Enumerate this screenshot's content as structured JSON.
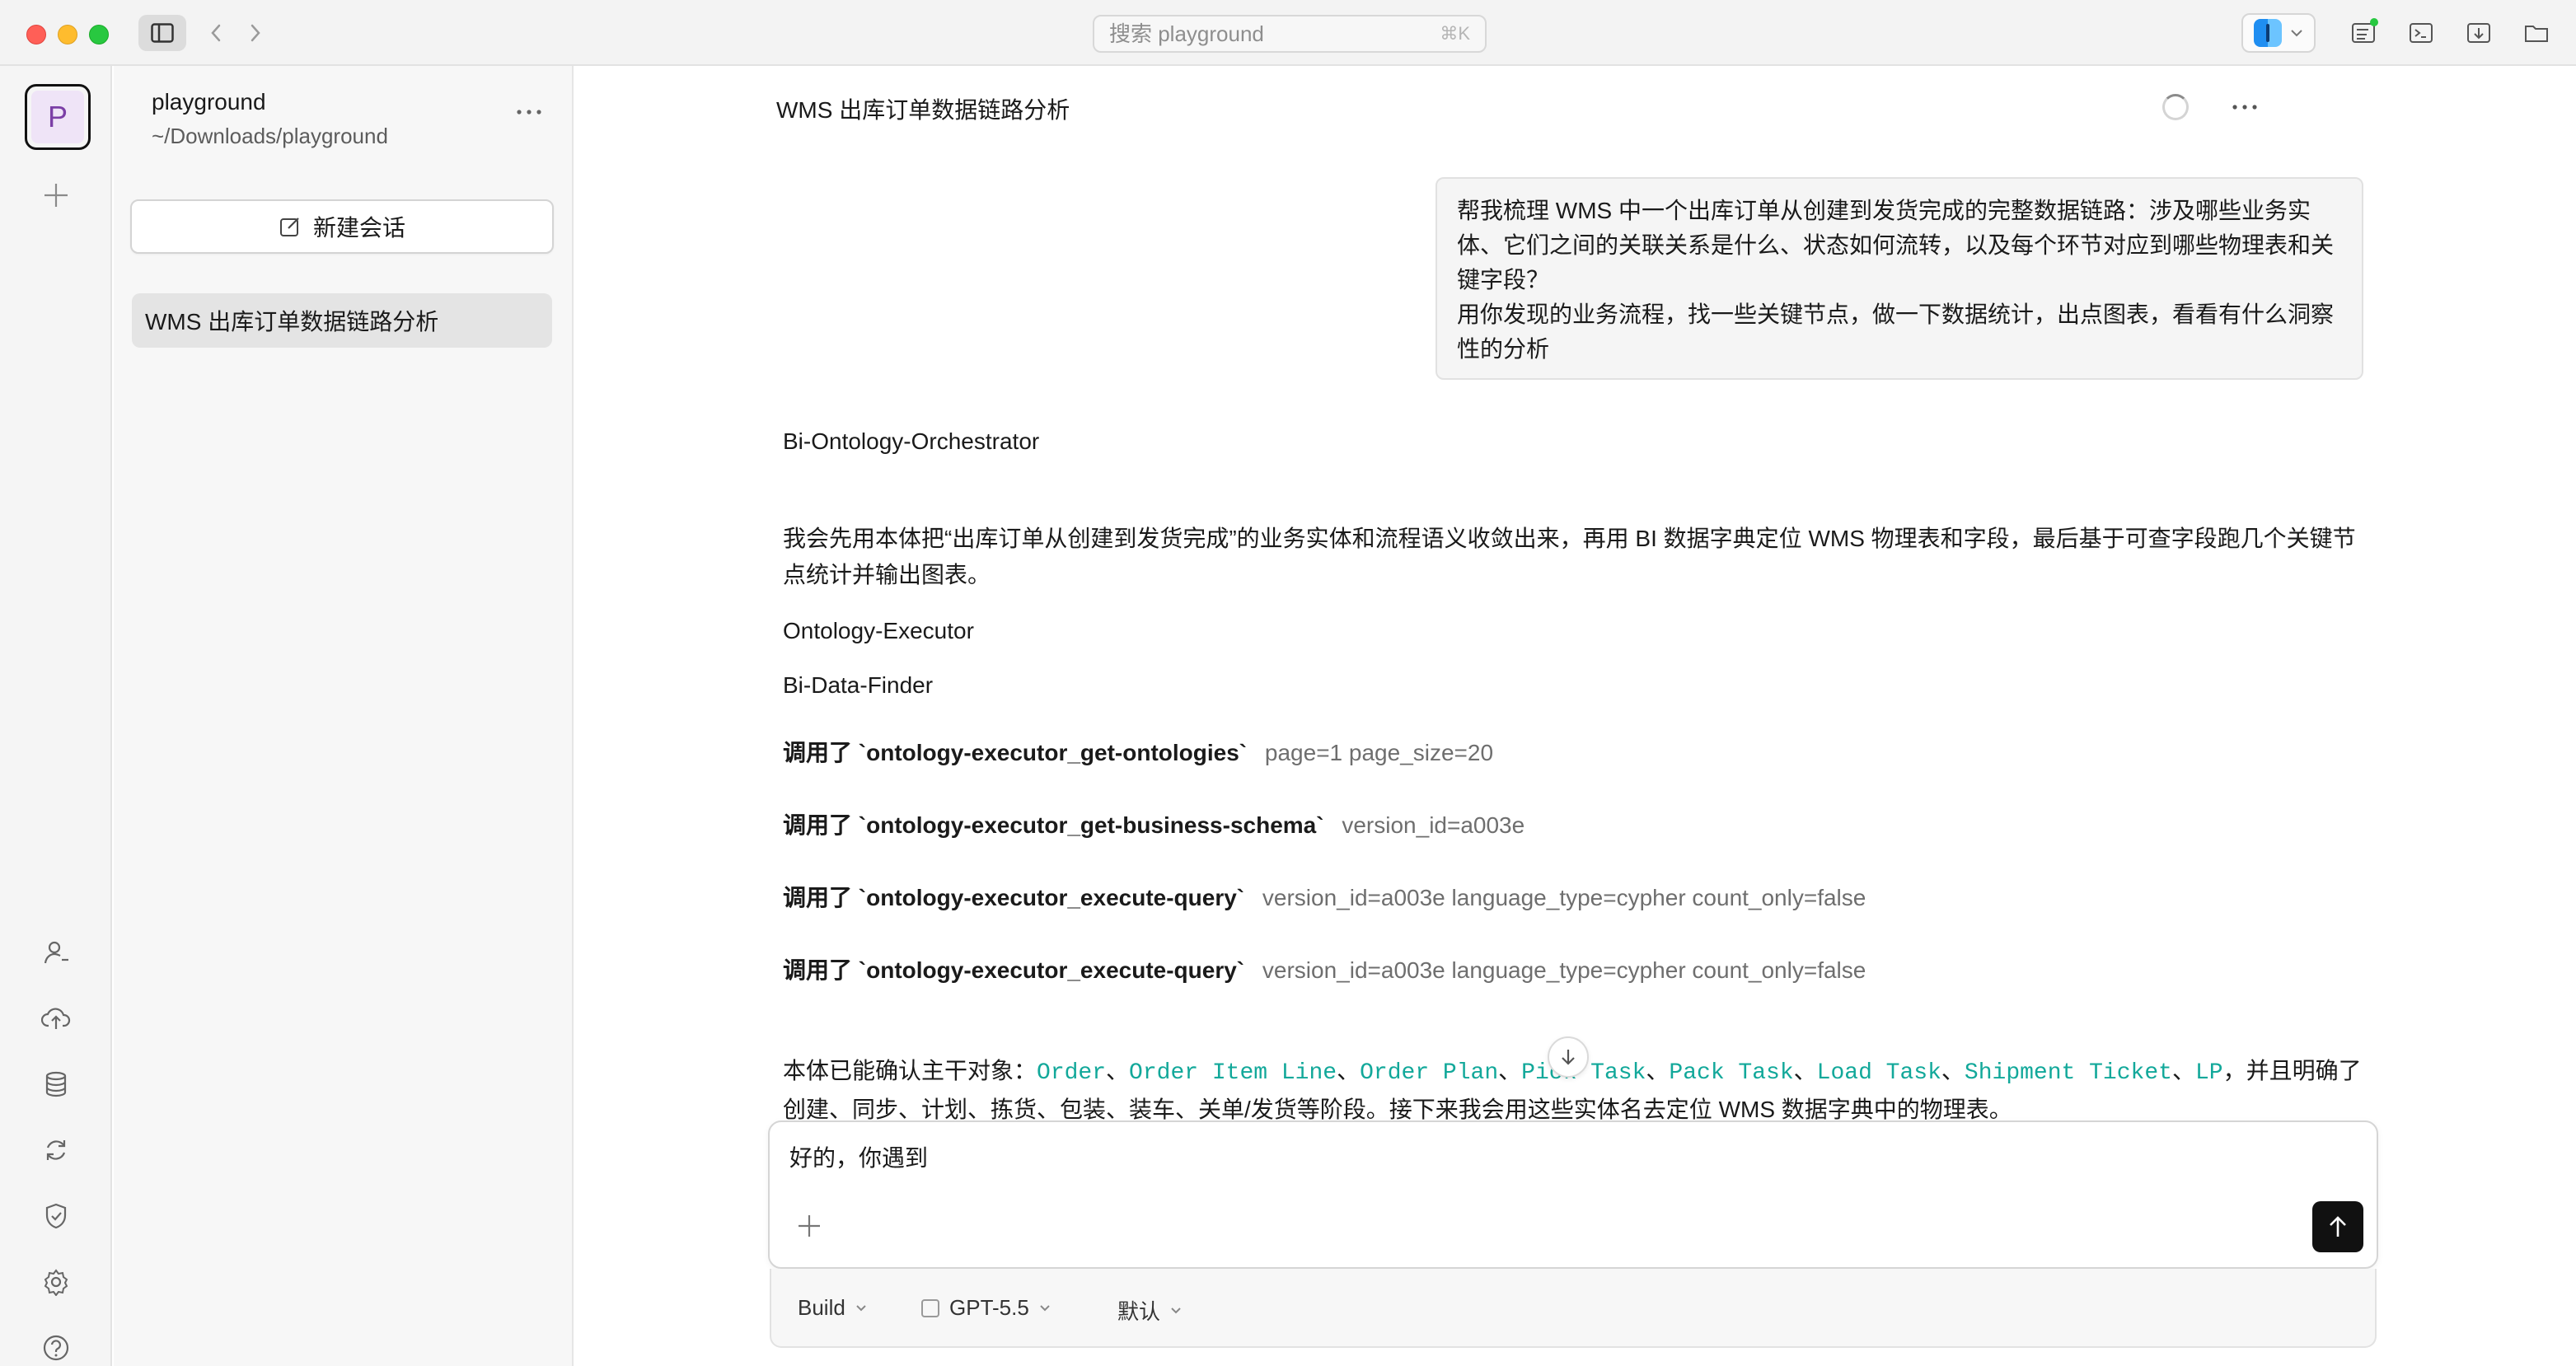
{
  "window": {
    "search_placeholder": "搜索 playground",
    "search_shortcut": "⌘K"
  },
  "rail": {
    "avatar_letter": "P",
    "icons": [
      "person-icon",
      "cloud-upload-icon",
      "database-icon",
      "refresh-icon",
      "shield-check-icon",
      "gear-icon",
      "help-icon"
    ]
  },
  "sidebar": {
    "project_name": "playground",
    "project_path": "~/Downloads/playground",
    "new_chat_label": "新建会话",
    "sessions": [
      {
        "label": "WMS 出库订单数据链路分析",
        "active": true
      }
    ]
  },
  "chat": {
    "title": "WMS 出库订单数据链路分析",
    "user_message": "帮我梳理 WMS 中一个出库订单从创建到发货完成的完整数据链路：涉及哪些业务实\n体、它们之间的关联关系是什么、状态如何流转，以及每个环节对应到哪些物理表和关\n键字段？\n用你发现的业务流程，找一些关键节点，做一下数据统计，出点图表，看看有什么洞察\n性的分析",
    "agent_label_1": "Bi-Ontology-Orchestrator",
    "agent_intro": "我会先用本体把“出库订单从创建到发货完成”的业务实体和流程语义收敛出来，再用 BI 数据字典定位 WMS 物理表和字段，最后基于可查字段跑几个关键节点统计并输出图表。",
    "agent_label_2": "Ontology-Executor",
    "agent_label_3": "Bi-Data-Finder",
    "tool_calls": [
      {
        "prefix": "调用了",
        "name": "`ontology-executor_get-ontologies`",
        "args": "page=1  page_size=20"
      },
      {
        "prefix": "调用了",
        "name": "`ontology-executor_get-business-schema`",
        "args": "version_id=a003e"
      },
      {
        "prefix": "调用了",
        "name": "`ontology-executor_execute-query`",
        "args": "version_id=a003e  language_type=cypher  count_only=false"
      },
      {
        "prefix": "调用了",
        "name": "`ontology-executor_execute-query`",
        "args": "version_id=a003e  language_type=cypher  count_only=false"
      }
    ],
    "summary_prefix": "本体已能确认主干对象：",
    "entities": [
      "Order",
      "Order Item Line",
      "Order Plan",
      "Pick Task",
      "Pack Task",
      "Load Task",
      "Shipment Ticket",
      "LP"
    ],
    "entity_separator": "、",
    "summary_suffix": "，并且明确了创建、同步、计划、拣货、包装、装车、关单/发货等阶段。接下来我会用这些实体名去定位 WMS 数据字典中的物理表。"
  },
  "composer": {
    "input_value": "好的，你遇到",
    "mode_label": "Build",
    "model_label": "GPT-5.5",
    "variant_label": "默认"
  }
}
